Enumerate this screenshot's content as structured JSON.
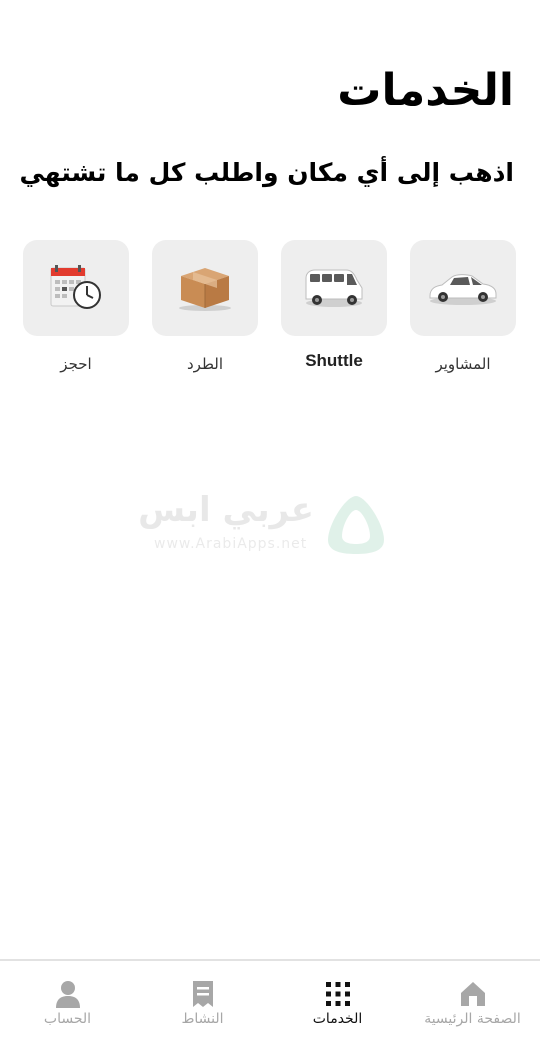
{
  "page_title": "الخدمات",
  "subtitle": "اذهب إلى أي مكان واطلب كل ما تشتهي",
  "services": [
    {
      "label": "المشاوير",
      "icon": "white-car-icon"
    },
    {
      "label": "Shuttle",
      "icon": "white-van-icon"
    },
    {
      "label": "الطرد",
      "icon": "package-box-icon"
    },
    {
      "label": "احجز",
      "icon": "calendar-clock-icon"
    }
  ],
  "watermark": {
    "name": "عربي ابس",
    "url": "www.ArabiApps.net",
    "icon": "arabiapps-logo-icon"
  },
  "bottom_nav": [
    {
      "label": "الصفحة الرئيسية",
      "icon": "home-icon",
      "active": false
    },
    {
      "label": "الخدمات",
      "icon": "grid-icon",
      "active": true
    },
    {
      "label": "النشاط",
      "icon": "receipt-icon",
      "active": false
    },
    {
      "label": "الحساب",
      "icon": "user-icon",
      "active": false
    }
  ],
  "colors": {
    "tile_background": "#eeeeee",
    "nav_active": "#111111",
    "nav_inactive": "#a7a7a7"
  }
}
